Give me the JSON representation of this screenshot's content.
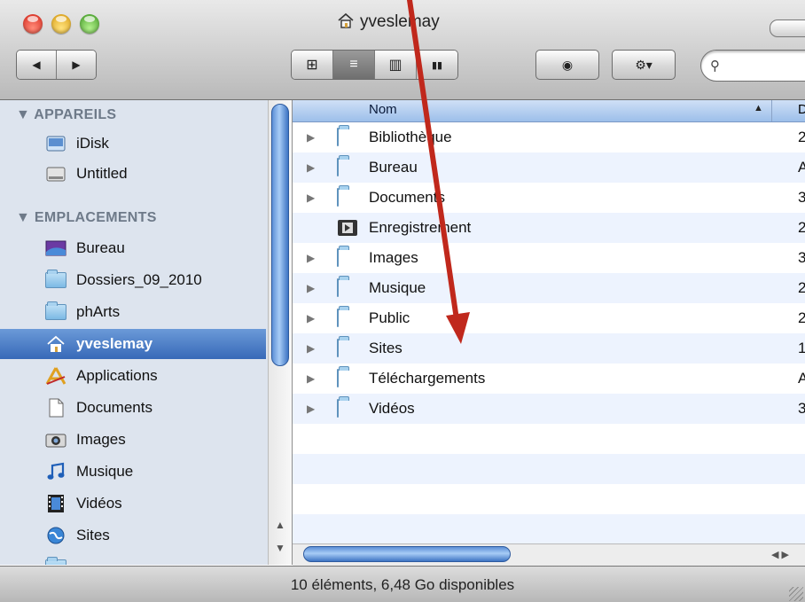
{
  "window": {
    "title": "yveslemay"
  },
  "toolbar": {
    "back_glyph": "◀",
    "forward_glyph": "▶",
    "views": [
      {
        "name": "icon-view",
        "glyph": "⊞"
      },
      {
        "name": "list-view",
        "glyph": "≡"
      },
      {
        "name": "column-view",
        "glyph": "▥"
      },
      {
        "name": "coverflow-view",
        "glyph": "▮▮"
      }
    ],
    "quicklook_glyph": "◉",
    "action_glyph": "⚙▾",
    "search_placeholder": "",
    "search_glyph": "⚲"
  },
  "sidebar": {
    "sections": [
      {
        "id": "devices",
        "label": "▼ APPAREILS"
      },
      {
        "id": "places",
        "label": "▼ EMPLACEMENTS"
      }
    ],
    "devices": [
      {
        "label": "iDisk",
        "icon": "idisk-icon"
      },
      {
        "label": "Untitled",
        "icon": "drive-icon"
      }
    ],
    "places": [
      {
        "label": "Bureau",
        "icon": "desktop-icon"
      },
      {
        "label": "Dossiers_09_2010",
        "icon": "folder-icon"
      },
      {
        "label": "phArts",
        "icon": "folder-icon"
      },
      {
        "label": "yveslemay",
        "icon": "home-icon",
        "selected": true
      },
      {
        "label": "Applications",
        "icon": "applications-icon"
      },
      {
        "label": "Documents",
        "icon": "documents-icon"
      },
      {
        "label": "Images",
        "icon": "camera-icon"
      },
      {
        "label": "Musique",
        "icon": "music-note-icon"
      },
      {
        "label": "Vidéos",
        "icon": "film-icon"
      },
      {
        "label": "Sites",
        "icon": "globe-icon"
      }
    ]
  },
  "list": {
    "columns": [
      {
        "label": "Nom"
      },
      {
        "label": "D"
      }
    ],
    "rows": [
      {
        "name": "Bibliothèque",
        "date": "2",
        "disclosure": true
      },
      {
        "name": "Bureau",
        "date": "A",
        "disclosure": true
      },
      {
        "name": "Documents",
        "date": "3",
        "disclosure": true
      },
      {
        "name": "Enregistrement",
        "date": "2",
        "disclosure": false
      },
      {
        "name": "Images",
        "date": "3",
        "disclosure": true
      },
      {
        "name": "Musique",
        "date": "2",
        "disclosure": true
      },
      {
        "name": "Public",
        "date": "2",
        "disclosure": true
      },
      {
        "name": "Sites",
        "date": "1",
        "disclosure": true
      },
      {
        "name": "Téléchargements",
        "date": "A",
        "disclosure": true
      },
      {
        "name": "Vidéos",
        "date": "3",
        "disclosure": true
      }
    ]
  },
  "status": {
    "text": "10 éléments, 6,48 Go disponibles"
  },
  "colors": {
    "selection": "#3769b8",
    "annotation_arrow": "#c0281c",
    "sidebar_bg": "#dde4ee"
  }
}
